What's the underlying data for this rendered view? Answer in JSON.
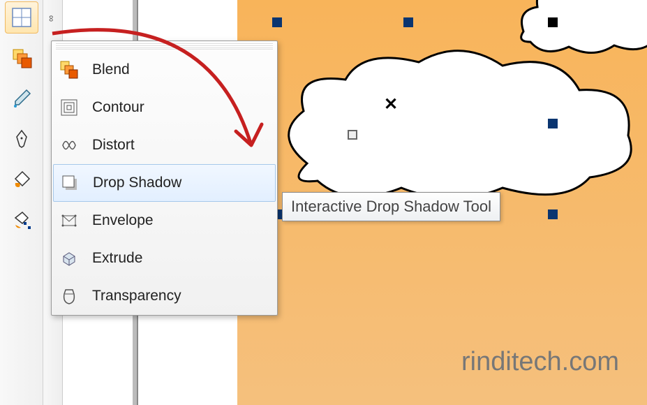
{
  "ruler": {
    "mark": "∞"
  },
  "toolbar": {
    "tools": [
      "table-tool",
      "blend-tool",
      "eyedropper-tool",
      "outline-pen-tool",
      "fill-tool",
      "interactive-fill-tool"
    ]
  },
  "flyout": {
    "items": [
      {
        "label": "Blend",
        "icon": "blend-icon"
      },
      {
        "label": "Contour",
        "icon": "contour-icon"
      },
      {
        "label": "Distort",
        "icon": "distort-icon"
      },
      {
        "label": "Drop Shadow",
        "icon": "drop-shadow-icon",
        "highlighted": true
      },
      {
        "label": "Envelope",
        "icon": "envelope-icon"
      },
      {
        "label": "Extrude",
        "icon": "extrude-icon"
      },
      {
        "label": "Transparency",
        "icon": "transparency-icon"
      }
    ]
  },
  "tooltip": {
    "text": "Interactive Drop Shadow Tool"
  },
  "canvas": {
    "center_glyph": "✕",
    "watermark": "rinditech.com"
  },
  "colors": {
    "canvas_top": "#f8b45a",
    "canvas_bottom": "#f5c07d",
    "selection": "#0a3570",
    "highlight_border": "#a6c8ea",
    "arrow": "#c62020"
  }
}
